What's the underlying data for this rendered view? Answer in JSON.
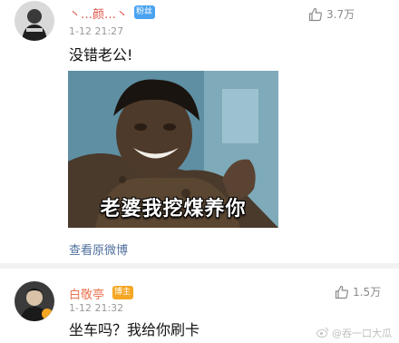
{
  "comments": [
    {
      "username": "丶…颜…丶",
      "badge": "粉丝",
      "timestamp": "1-12 21:27",
      "text": "没错老公!",
      "likes": "3.7万",
      "meme_caption": "老婆我挖煤养你",
      "view_original": "查看原微博"
    },
    {
      "username": "白敬亭",
      "badge": "博主",
      "timestamp": "1-12 21:32",
      "text": "坐车吗？我给你刷卡",
      "likes": "1.5万"
    }
  ],
  "watermark": "@吞一口大瓜",
  "colors": {
    "username": "#eb7350",
    "badge_blue": "#4aa3f0",
    "badge_orange": "#f5a623",
    "link": "#4f6f9c",
    "separator": "#f2f2f2"
  },
  "icons": [
    "thumbs-up-icon",
    "weibo-logo-icon"
  ]
}
